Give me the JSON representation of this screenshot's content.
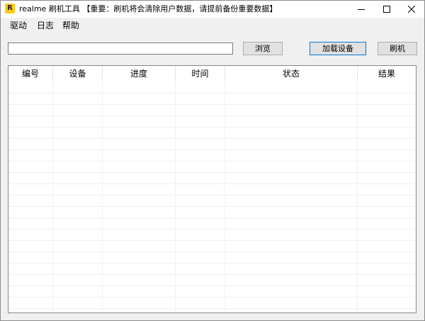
{
  "window": {
    "icon_letter": "R",
    "title": "realme 刷机工具 【重要：刷机将会清除用户数据，请提前备份重要数据】"
  },
  "menu": {
    "items": [
      {
        "label": "驱动"
      },
      {
        "label": "日志"
      },
      {
        "label": "帮助"
      }
    ]
  },
  "toolbar": {
    "path_value": "",
    "browse_label": "浏览",
    "load_device_label": "加载设备",
    "flash_label": "刷机"
  },
  "table": {
    "columns": [
      {
        "label": "编号"
      },
      {
        "label": "设备"
      },
      {
        "label": "进度"
      },
      {
        "label": "时间"
      },
      {
        "label": "状态"
      },
      {
        "label": "结果"
      }
    ],
    "rows": []
  },
  "colors": {
    "app_icon": "#ffc915",
    "default_button_border": "#0078d7"
  }
}
